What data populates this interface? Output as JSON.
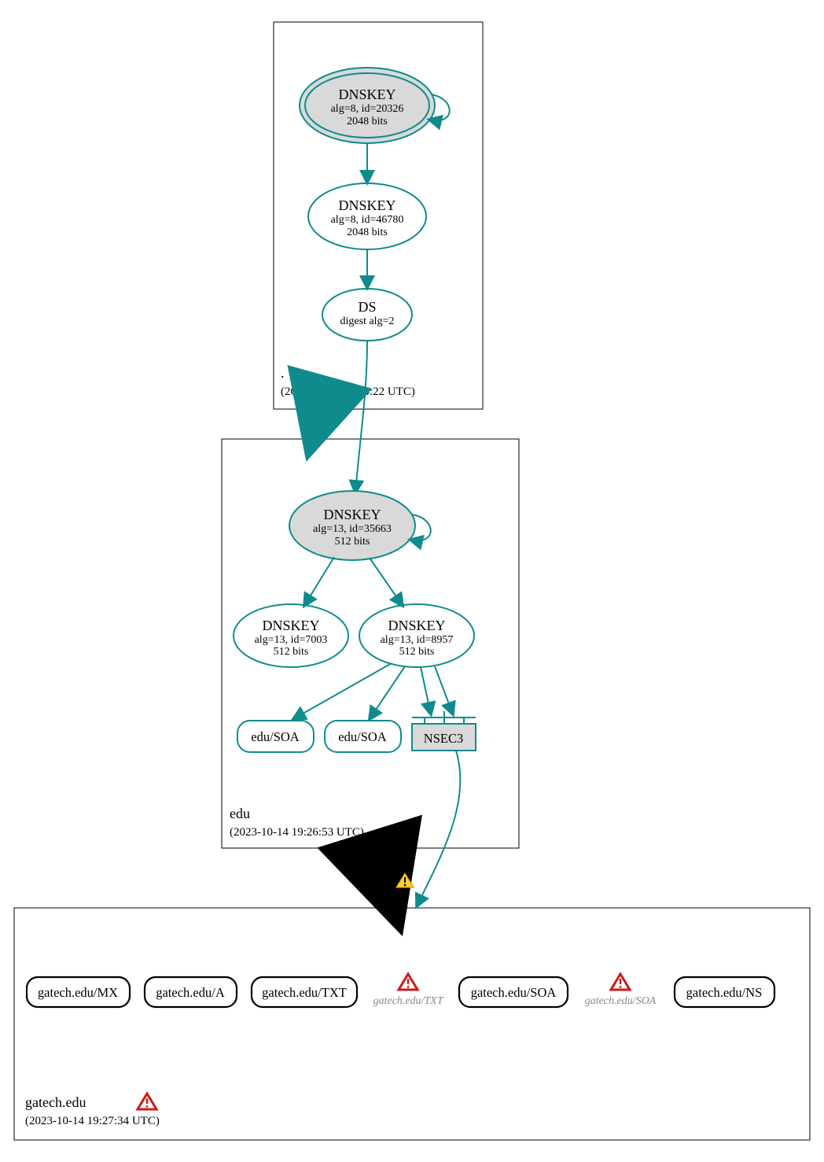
{
  "colors": {
    "teal": "#0f8b8d",
    "grey": "#d9d9d9",
    "black": "#000"
  },
  "zones": {
    "root": {
      "label": ".",
      "ts": "(2023-10-14 15:44:22 UTC)"
    },
    "edu": {
      "label": "edu",
      "ts": "(2023-10-14 19:26:53 UTC)"
    },
    "gatech": {
      "label": "gatech.edu",
      "ts": "(2023-10-14 19:27:34 UTC)"
    }
  },
  "nodes": {
    "root_ksk": {
      "title": "DNSKEY",
      "l1": "alg=8, id=20326",
      "l2": "2048 bits"
    },
    "root_zsk": {
      "title": "DNSKEY",
      "l1": "alg=8, id=46780",
      "l2": "2048 bits"
    },
    "root_ds": {
      "title": "DS",
      "l1": "digest alg=2"
    },
    "edu_ksk": {
      "title": "DNSKEY",
      "l1": "alg=13, id=35663",
      "l2": "512 bits"
    },
    "edu_zsk1": {
      "title": "DNSKEY",
      "l1": "alg=13, id=7003",
      "l2": "512 bits"
    },
    "edu_zsk2": {
      "title": "DNSKEY",
      "l1": "alg=13, id=8957",
      "l2": "512 bits"
    },
    "edu_soa1": {
      "label": "edu/SOA"
    },
    "edu_soa2": {
      "label": "edu/SOA"
    },
    "nsec3": {
      "label": "NSEC3"
    }
  },
  "rr": {
    "mx": {
      "label": "gatech.edu/MX"
    },
    "a": {
      "label": "gatech.edu/A"
    },
    "txt": {
      "label": "gatech.edu/TXT"
    },
    "txt_err": {
      "label": "gatech.edu/TXT"
    },
    "soa": {
      "label": "gatech.edu/SOA"
    },
    "soa_err": {
      "label": "gatech.edu/SOA"
    },
    "ns": {
      "label": "gatech.edu/NS"
    }
  }
}
